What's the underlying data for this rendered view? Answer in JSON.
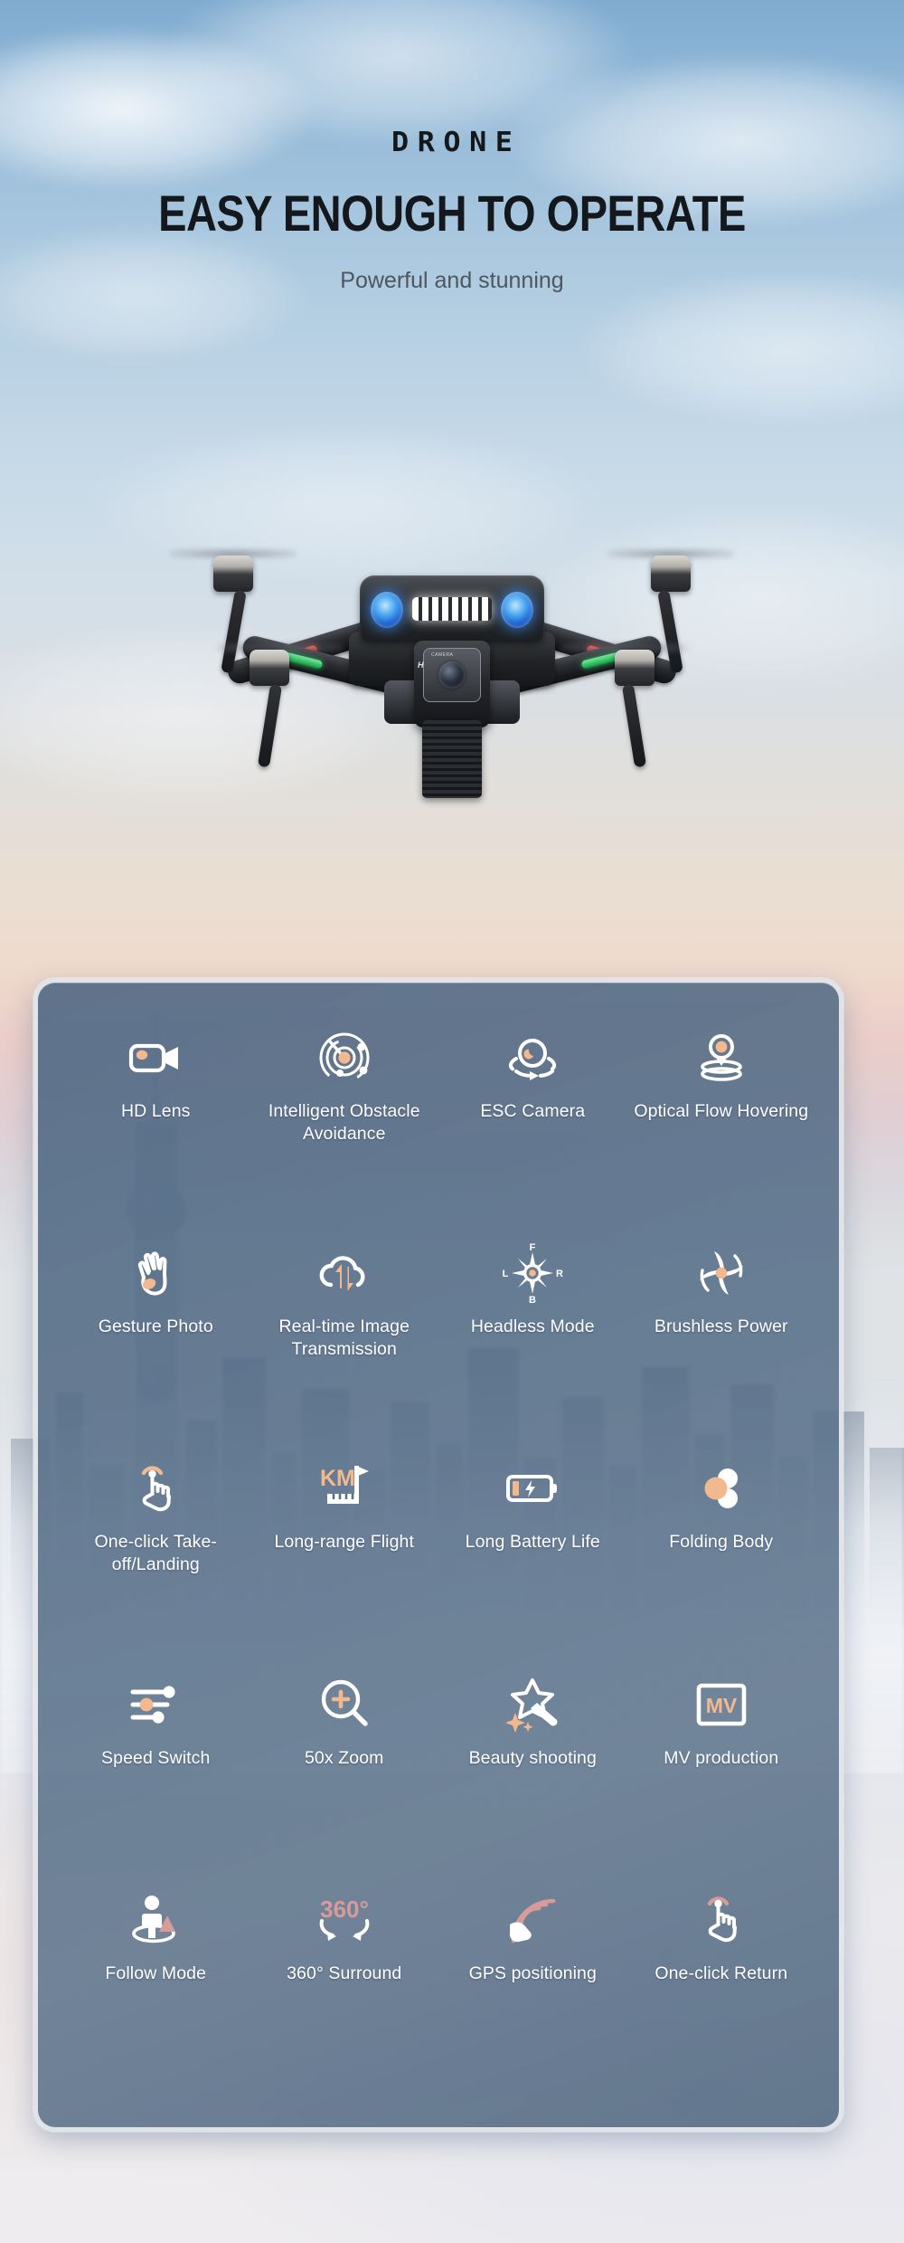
{
  "header": {
    "wordmark": "DRONE",
    "headline": "EASY ENOUGH TO OPERATE",
    "subhead": "Powerful and stunning"
  },
  "product": {
    "camera_badge": "CAMERA",
    "brand_initial": "H"
  },
  "colors": {
    "panel_fill": "#566E88",
    "panel_border": "#FFFFFF",
    "accent_peach": "#F2B98E",
    "accent_rose": "#D79B99",
    "icon_white": "#FFFFFF",
    "headline_text": "#14181C",
    "subhead_text": "#4E565E",
    "sky_top": "#7FABD0",
    "sky_bottom": "#EEE1D8"
  },
  "features": [
    {
      "icon": "hd-lens-icon",
      "label": "HD Lens"
    },
    {
      "icon": "obstacle-avoidance-icon",
      "label": "Intelligent Obstacle Avoidance"
    },
    {
      "icon": "esc-camera-icon",
      "label": "ESC Camera"
    },
    {
      "icon": "optical-flow-hovering-icon",
      "label": "Optical Flow Hovering"
    },
    {
      "icon": "gesture-photo-icon",
      "label": "Gesture Photo"
    },
    {
      "icon": "image-transmission-icon",
      "label": "Real-time Image Transmission"
    },
    {
      "icon": "headless-mode-icon",
      "label": "Headless Mode"
    },
    {
      "icon": "brushless-power-icon",
      "label": "Brushless Power"
    },
    {
      "icon": "one-click-takeoff-icon",
      "label": "One-click Take-off/Landing"
    },
    {
      "icon": "long-range-flight-icon",
      "label": "Long-range Flight"
    },
    {
      "icon": "long-battery-life-icon",
      "label": "Long Battery Life"
    },
    {
      "icon": "folding-body-icon",
      "label": "Folding Body"
    },
    {
      "icon": "speed-switch-icon",
      "label": "Speed Switch"
    },
    {
      "icon": "zoom-50x-icon",
      "label": "50x Zoom"
    },
    {
      "icon": "beauty-shooting-icon",
      "label": "Beauty shooting"
    },
    {
      "icon": "mv-production-icon",
      "label": "MV production"
    },
    {
      "icon": "follow-mode-icon",
      "label": "Follow Mode"
    },
    {
      "icon": "surround-360-icon",
      "label": "360° Surround"
    },
    {
      "icon": "gps-positioning-icon",
      "label": "GPS positioning"
    },
    {
      "icon": "one-click-return-icon",
      "label": "One-click Return"
    }
  ],
  "icon_text": {
    "compass_front": "F",
    "compass_left": "L",
    "compass_right": "R",
    "compass_back": "B",
    "km": "KM",
    "mv": "MV",
    "deg360": "360°"
  }
}
